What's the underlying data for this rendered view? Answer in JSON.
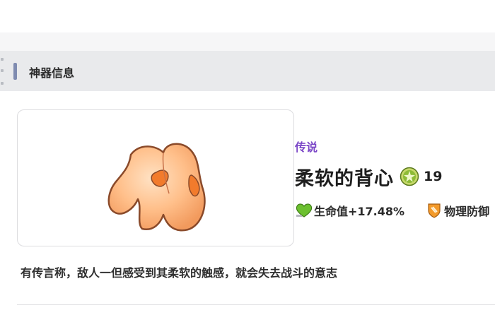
{
  "section": {
    "title": "神器信息"
  },
  "artifact": {
    "rarity": "传说",
    "name": "柔软的背心",
    "level": "19",
    "icons": {
      "level": "green-star-badge-icon",
      "hp": "green-heart-icon",
      "defense": "orange-shield-icon"
    },
    "stats": [
      {
        "label": "生命值+17.48%"
      },
      {
        "label": "物理防御"
      }
    ],
    "description": "有传言称，敌人一但感受到其柔软的触感，就会失去战斗的意志"
  },
  "colors": {
    "rarity": "#7b46c7",
    "accent_bar": "#7f8bb0",
    "header_bg": "#e9eaec"
  }
}
